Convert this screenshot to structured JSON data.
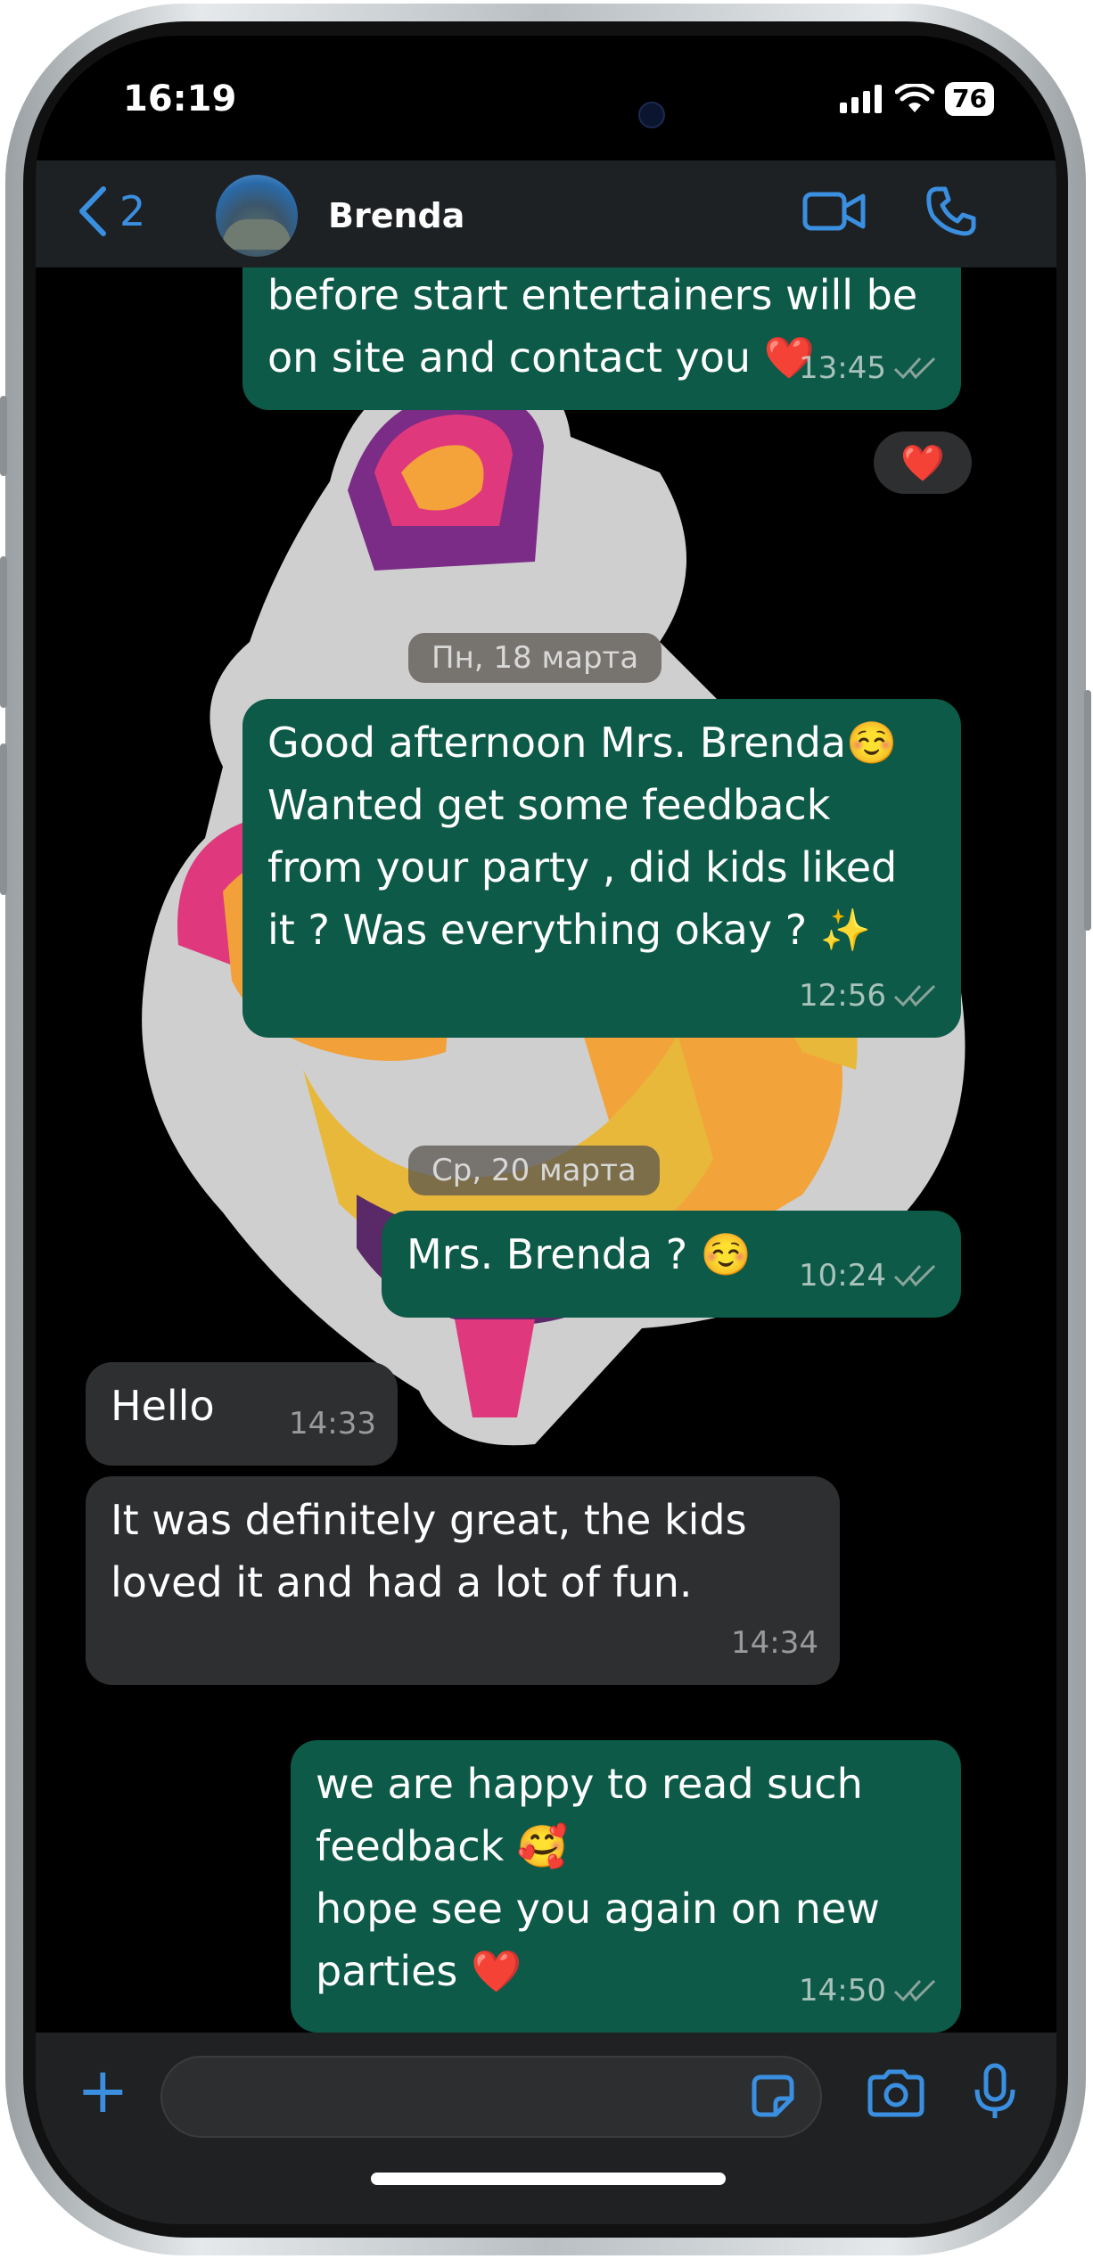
{
  "status_bar": {
    "time": "16:19",
    "battery": "76"
  },
  "header": {
    "back_count": "2",
    "contact_name": "Brenda"
  },
  "messages": [
    {
      "text_lines": [
        "before start entertainers will be",
        "on site and contact you ❤️"
      ],
      "time": "13:45"
    },
    {
      "reaction": "❤️"
    },
    {
      "date": "Пн, 18 марта"
    },
    {
      "text_lines": [
        "Good afternoon Mrs. Brenda☺️",
        "Wanted get some feedback",
        "from your party , did kids liked",
        "it ? Was everything okay ? ✨"
      ],
      "time": "12:56"
    },
    {
      "date": "Ср, 20 марта"
    },
    {
      "text": "Mrs. Brenda ? ☺️",
      "time": "10:24"
    },
    {
      "text": "Hello",
      "time": "14:33"
    },
    {
      "text_lines": [
        "It was definitely great, the kids",
        "loved it and had a lot of fun."
      ],
      "time": "14:34"
    },
    {
      "text_lines": [
        "we are happy to read such",
        "feedback 🥰",
        "hope see you again on new",
        "parties ❤️"
      ],
      "time": "14:50"
    }
  ],
  "colors": {
    "outgoing_bubble": "#0c5a47",
    "incoming_bubble": "#2e2f31",
    "accent": "#3a8fe0"
  },
  "icons": [
    "video-call-icon",
    "voice-call-icon",
    "plus-icon",
    "sticker-icon",
    "camera-icon",
    "microphone-icon",
    "read-checkmarks-icon"
  ]
}
